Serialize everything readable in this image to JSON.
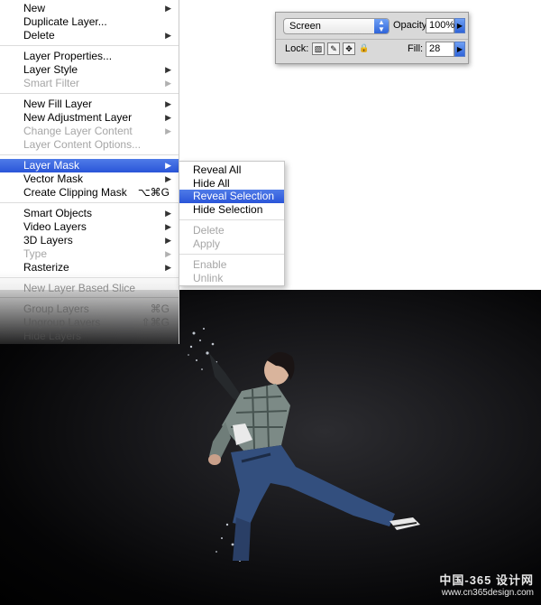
{
  "context_menu": {
    "items": [
      {
        "label": "New",
        "arrow": "▶",
        "state": "normal"
      },
      {
        "label": "Duplicate Layer...",
        "arrow": "",
        "state": "normal"
      },
      {
        "label": "Delete",
        "arrow": "▶",
        "state": "normal"
      },
      {
        "label": "Layer Properties...",
        "arrow": "",
        "state": "normal"
      },
      {
        "label": "Layer Style",
        "arrow": "▶",
        "state": "normal"
      },
      {
        "label": "Smart Filter",
        "arrow": "▶",
        "state": "disabled"
      },
      {
        "label": "New Fill Layer",
        "arrow": "▶",
        "state": "normal"
      },
      {
        "label": "New Adjustment Layer",
        "arrow": "▶",
        "state": "normal"
      },
      {
        "label": "Change Layer Content",
        "arrow": "▶",
        "state": "disabled"
      },
      {
        "label": "Layer Content Options...",
        "arrow": "",
        "state": "disabled"
      },
      {
        "label": "Layer Mask",
        "arrow": "▶",
        "state": "selected"
      },
      {
        "label": "Vector Mask",
        "arrow": "▶",
        "state": "normal"
      },
      {
        "label": "Create Clipping Mask",
        "shortcut": "⌥⌘G",
        "state": "normal"
      },
      {
        "label": "Smart Objects",
        "arrow": "▶",
        "state": "normal"
      },
      {
        "label": "Video Layers",
        "arrow": "▶",
        "state": "normal"
      },
      {
        "label": "3D Layers",
        "arrow": "▶",
        "state": "normal"
      },
      {
        "label": "Type",
        "arrow": "▶",
        "state": "disabled"
      },
      {
        "label": "Rasterize",
        "arrow": "▶",
        "state": "normal"
      },
      {
        "label": "New Layer Based Slice",
        "arrow": "",
        "state": "normal"
      },
      {
        "label": "Group Layers",
        "shortcut": "⌘G",
        "state": "normal"
      },
      {
        "label": "Ungroup Layers",
        "shortcut": "⇧⌘G",
        "state": "disabled"
      },
      {
        "label": "Hide Layers",
        "arrow": "",
        "state": "normal"
      }
    ]
  },
  "layer_mask_submenu": {
    "items": [
      {
        "label": "Reveal All",
        "state": "normal"
      },
      {
        "label": "Hide All",
        "state": "normal"
      },
      {
        "label": "Reveal Selection",
        "state": "selected"
      },
      {
        "label": "Hide Selection",
        "state": "normal"
      },
      {
        "label": "Delete",
        "state": "disabled"
      },
      {
        "label": "Apply",
        "state": "disabled"
      },
      {
        "label": "Enable",
        "state": "disabled"
      },
      {
        "label": "Unlink",
        "state": "disabled"
      }
    ]
  },
  "layers_panel": {
    "blend_mode": "Screen",
    "opacity_label": "Opacity:",
    "opacity_value": "100%",
    "lock_label": "Lock:",
    "fill_label": "Fill:",
    "fill_value": "28"
  },
  "watermark": {
    "line1": "中国-365 设计网",
    "line2": "www.cn365design.com"
  },
  "colors": {
    "menu_highlight": "#3563dc",
    "photo_background": "#0b0b0d"
  },
  "icons": {
    "submenu_arrow": "triangle-right-icon",
    "dropdown": "chevron-updown-icon",
    "lock_transparent": "checkerboard-lock-icon",
    "lock_image": "brush-lock-icon",
    "lock_position": "move-lock-icon",
    "lock_all": "padlock-icon"
  }
}
